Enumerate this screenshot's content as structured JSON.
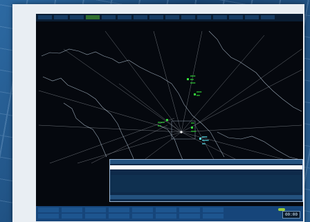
{
  "topbar": {
    "buttons": [
      "",
      "",
      "",
      "",
      "",
      "",
      "",
      "",
      "",
      "",
      "",
      "",
      "",
      "",
      ""
    ],
    "active_index": [
      3
    ]
  },
  "flight_list": {
    "header": [
      "",
      "",
      "",
      "",
      "",
      "",
      ""
    ],
    "rows": [
      [
        "",
        "",
        "",
        "",
        "",
        "",
        ""
      ]
    ],
    "header2": [
      "",
      "",
      "",
      "",
      "",
      "",
      ""
    ]
  },
  "map": {
    "tracks_green": [
      {
        "name": "",
        "id": "t1"
      },
      {
        "name": "",
        "id": "t2"
      },
      {
        "name": "",
        "id": "t3"
      }
    ],
    "tracks_cyan": [
      {
        "name": "",
        "id": "c1"
      }
    ]
  },
  "bottom_bar": {
    "columns": [
      [
        "",
        ""
      ],
      [
        "",
        ""
      ],
      [
        "",
        ""
      ],
      [
        "",
        ""
      ],
      [
        "",
        ""
      ],
      [
        "",
        ""
      ],
      [
        "",
        ""
      ],
      [
        "",
        ""
      ]
    ]
  },
  "clock": "00:00",
  "colors": {
    "screen_bg": "#05080e",
    "track_green": "#35e03a",
    "track_cyan": "#5ff0ff",
    "ui_blue": "#16457a"
  }
}
